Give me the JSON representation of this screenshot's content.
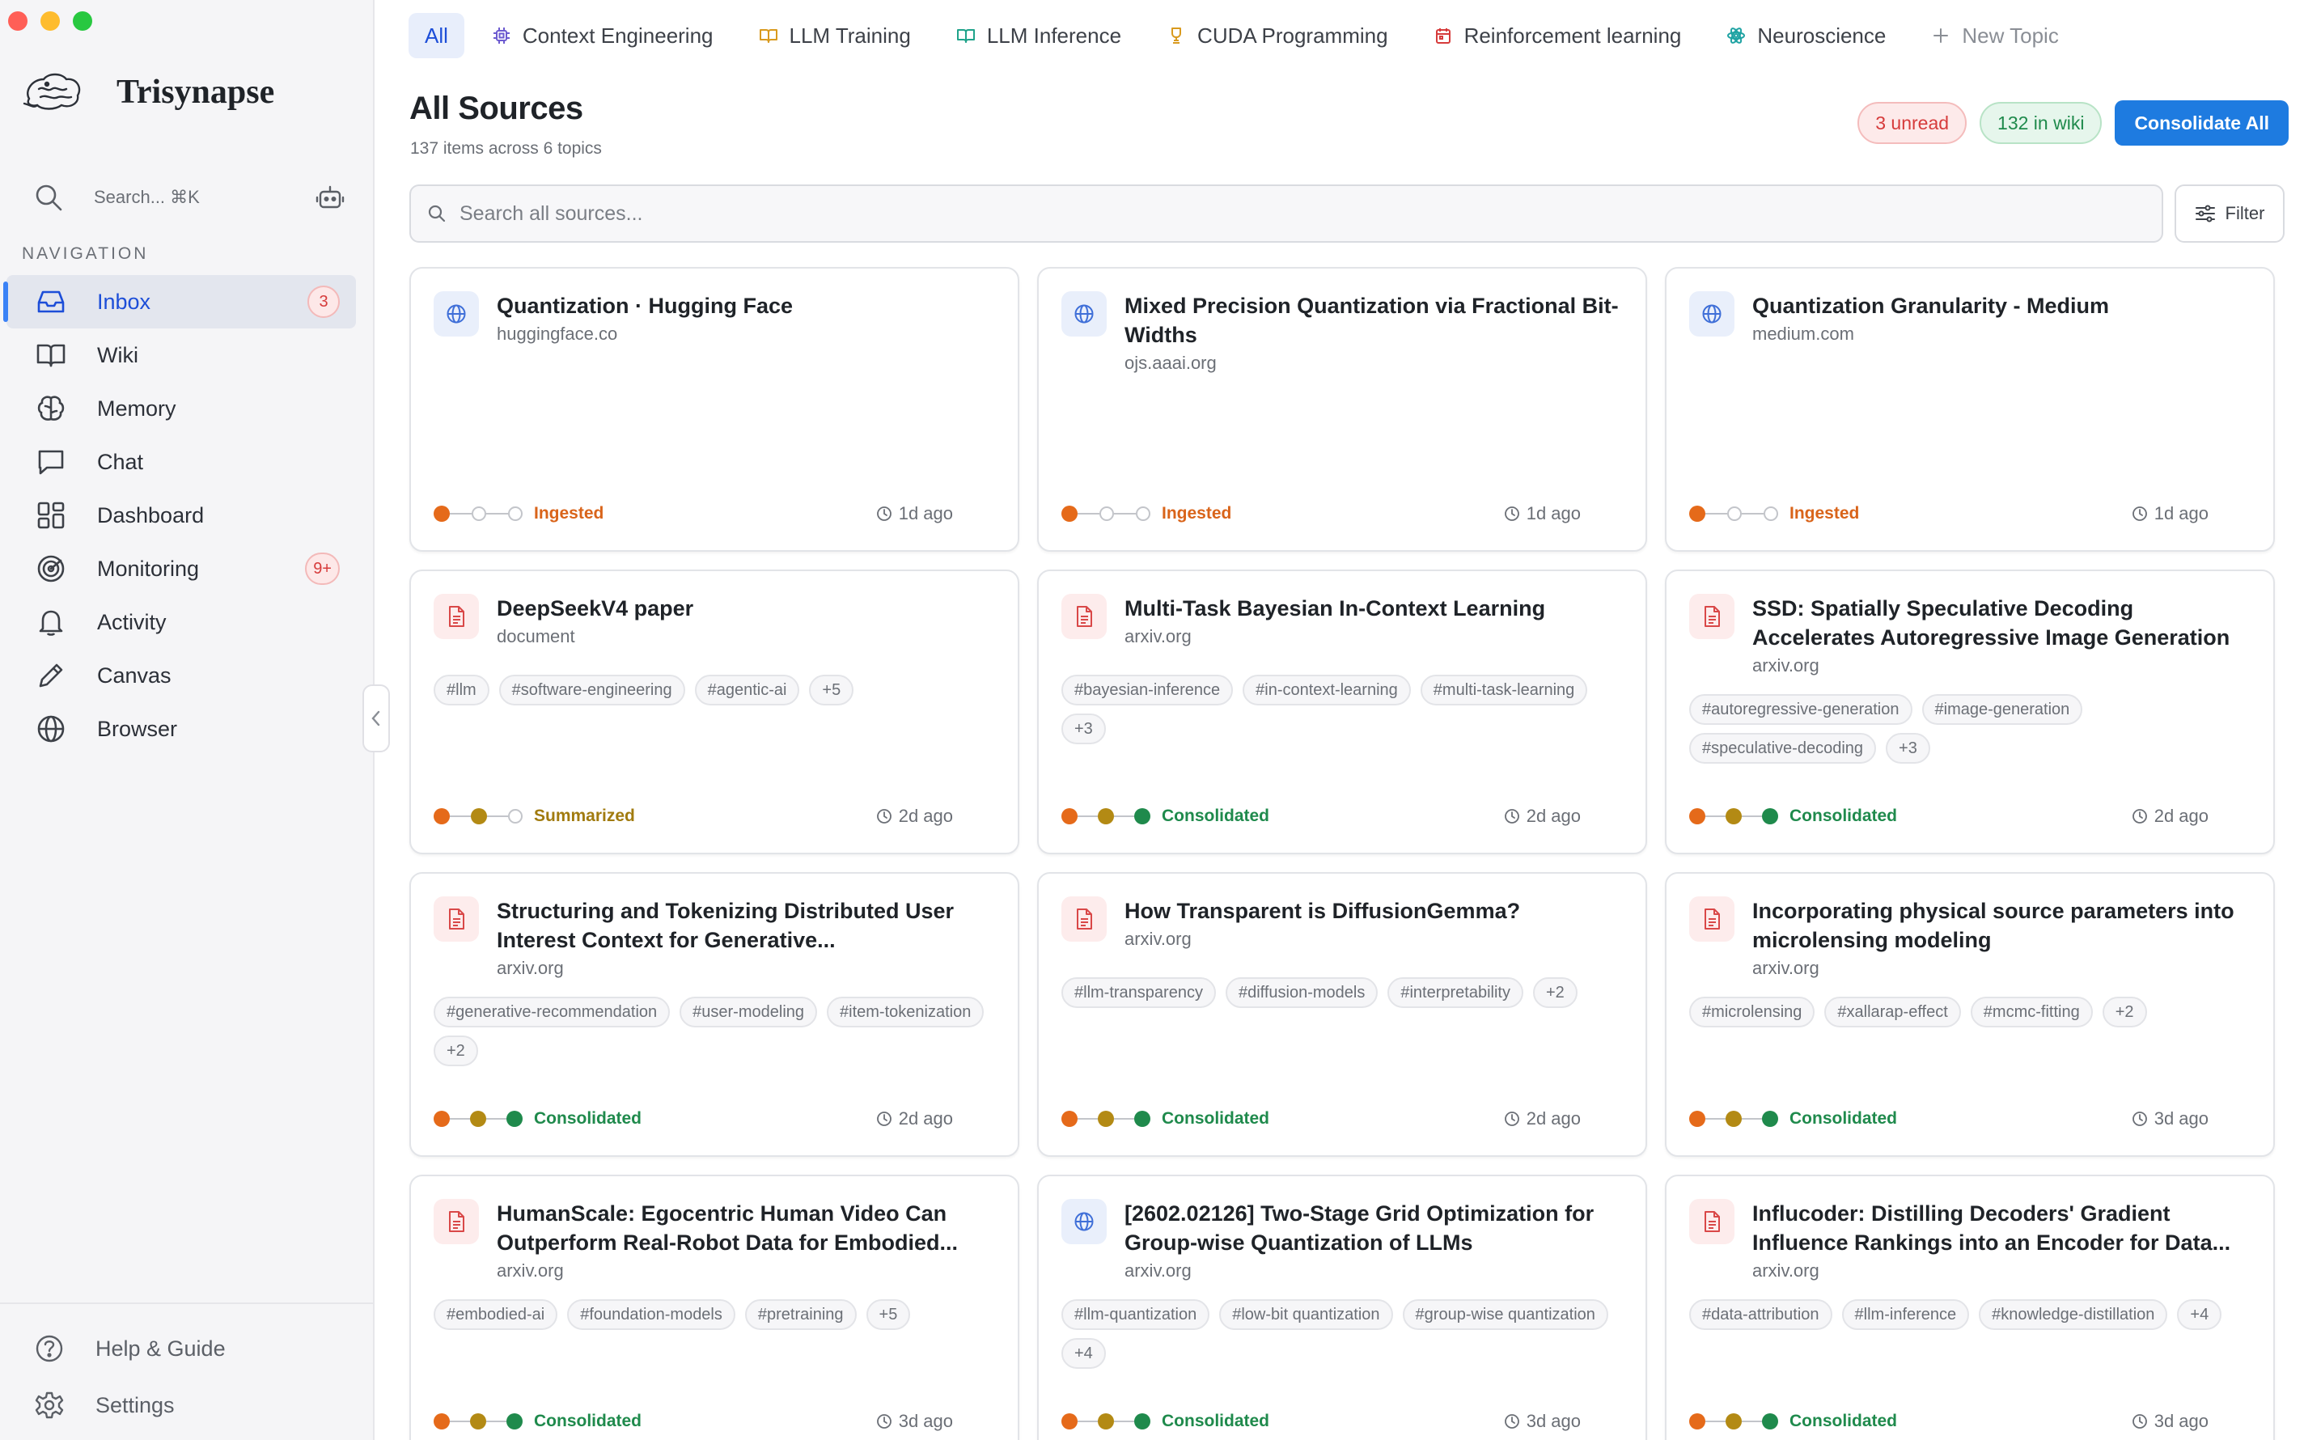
{
  "app": {
    "name": "Trisynapse"
  },
  "search": {
    "placeholder": "Search... ⌘K"
  },
  "nav": {
    "heading": "NAVIGATION",
    "items": [
      {
        "key": "inbox",
        "label": "Inbox",
        "badge": "3",
        "active": true
      },
      {
        "key": "wiki",
        "label": "Wiki"
      },
      {
        "key": "memory",
        "label": "Memory"
      },
      {
        "key": "chat",
        "label": "Chat"
      },
      {
        "key": "dashboard",
        "label": "Dashboard"
      },
      {
        "key": "monitoring",
        "label": "Monitoring",
        "badge": "9+"
      },
      {
        "key": "activity",
        "label": "Activity"
      },
      {
        "key": "canvas",
        "label": "Canvas"
      },
      {
        "key": "browser",
        "label": "Browser"
      }
    ],
    "bottom": [
      {
        "key": "help",
        "label": "Help & Guide"
      },
      {
        "key": "settings",
        "label": "Settings"
      }
    ]
  },
  "topics": [
    {
      "label": "All",
      "active": true
    },
    {
      "label": "Context Engineering",
      "icon": "cpu-icon",
      "color": "#6d5bd0"
    },
    {
      "label": "LLM Training",
      "icon": "book-icon",
      "color": "#d99a1e"
    },
    {
      "label": "LLM Inference",
      "icon": "book-open-icon",
      "color": "#1fa38a"
    },
    {
      "label": "CUDA Programming",
      "icon": "trophy-icon",
      "color": "#d99a1e"
    },
    {
      "label": "Reinforcement learning",
      "icon": "calendar-icon",
      "color": "#d63b3b"
    },
    {
      "label": "Neuroscience",
      "icon": "atom-icon",
      "color": "#1fa3a3"
    },
    {
      "label": "New Topic",
      "icon": "plus-icon",
      "new": true
    }
  ],
  "header": {
    "title": "All Sources",
    "subtitle": "137 items across 6 topics",
    "unread": "3 unread",
    "wiki": "132 in wiki",
    "consolidate": "Consolidate All"
  },
  "mainSearch": {
    "placeholder": "Search all sources..."
  },
  "filter": {
    "label": "Filter"
  },
  "colors": {
    "accent": "#1e7be0",
    "ingested": "#e56a1a",
    "summarized": "#b38a14",
    "consolidated": "#1f8a4c"
  },
  "cards": [
    {
      "type": "web",
      "title": "Quantization · Hugging Face",
      "domain": "huggingface.co",
      "tags": [],
      "stage": 1,
      "status": "Ingested",
      "time": "1d ago"
    },
    {
      "type": "web",
      "title": "Mixed Precision Quantization via Fractional Bit-Widths",
      "domain": "ojs.aaai.org",
      "tags": [],
      "stage": 1,
      "status": "Ingested",
      "time": "1d ago"
    },
    {
      "type": "web",
      "title": "Quantization Granularity - Medium",
      "domain": "medium.com",
      "tags": [],
      "stage": 1,
      "status": "Ingested",
      "time": "1d ago"
    },
    {
      "type": "doc",
      "title": "DeepSeekV4 paper",
      "domain": "document",
      "tags": [
        "#llm",
        "#software-engineering",
        "#agentic-ai",
        "+5"
      ],
      "stage": 2,
      "status": "Summarized",
      "time": "2d ago"
    },
    {
      "type": "doc",
      "title": "Multi-Task Bayesian In-Context Learning",
      "domain": "arxiv.org",
      "tags": [
        "#bayesian-inference",
        "#in-context-learning",
        "#multi-task-learning",
        "+3"
      ],
      "stage": 3,
      "status": "Consolidated",
      "time": "2d ago"
    },
    {
      "type": "doc",
      "title": "SSD: Spatially Speculative Decoding Accelerates Autoregressive Image Generation",
      "domain": "arxiv.org",
      "tags": [
        "#autoregressive-generation",
        "#image-generation",
        "#speculative-decoding",
        "+3"
      ],
      "stage": 3,
      "status": "Consolidated",
      "time": "2d ago"
    },
    {
      "type": "doc",
      "title": "Structuring and Tokenizing Distributed User Interest Context for Generative...",
      "domain": "arxiv.org",
      "tags": [
        "#generative-recommendation",
        "#user-modeling",
        "#item-tokenization",
        "+2"
      ],
      "stage": 3,
      "status": "Consolidated",
      "time": "2d ago"
    },
    {
      "type": "doc",
      "title": "How Transparent is DiffusionGemma?",
      "domain": "arxiv.org",
      "tags": [
        "#llm-transparency",
        "#diffusion-models",
        "#interpretability",
        "+2"
      ],
      "stage": 3,
      "status": "Consolidated",
      "time": "2d ago"
    },
    {
      "type": "doc",
      "title": "Incorporating physical source parameters into microlensing modeling",
      "domain": "arxiv.org",
      "tags": [
        "#microlensing",
        "#xallarap-effect",
        "#mcmc-fitting",
        "+2"
      ],
      "stage": 3,
      "status": "Consolidated",
      "time": "3d ago"
    },
    {
      "type": "doc",
      "title": "HumanScale: Egocentric Human Video Can Outperform Real-Robot Data for Embodied...",
      "domain": "arxiv.org",
      "tags": [
        "#embodied-ai",
        "#foundation-models",
        "#pretraining",
        "+5"
      ],
      "stage": 3,
      "status": "Consolidated",
      "time": "3d ago"
    },
    {
      "type": "web",
      "title": "[2602.02126] Two-Stage Grid Optimization for Group-wise Quantization of LLMs",
      "domain": "arxiv.org",
      "tags": [
        "#llm-quantization",
        "#low-bit quantization",
        "#group-wise quantization",
        "+4"
      ],
      "stage": 3,
      "status": "Consolidated",
      "time": "3d ago"
    },
    {
      "type": "doc",
      "title": "Influcoder: Distilling Decoders' Gradient Influence Rankings into an Encoder for Data...",
      "domain": "arxiv.org",
      "tags": [
        "#data-attribution",
        "#llm-inference",
        "#knowledge-distillation",
        "+4"
      ],
      "stage": 3,
      "status": "Consolidated",
      "time": "3d ago"
    }
  ]
}
